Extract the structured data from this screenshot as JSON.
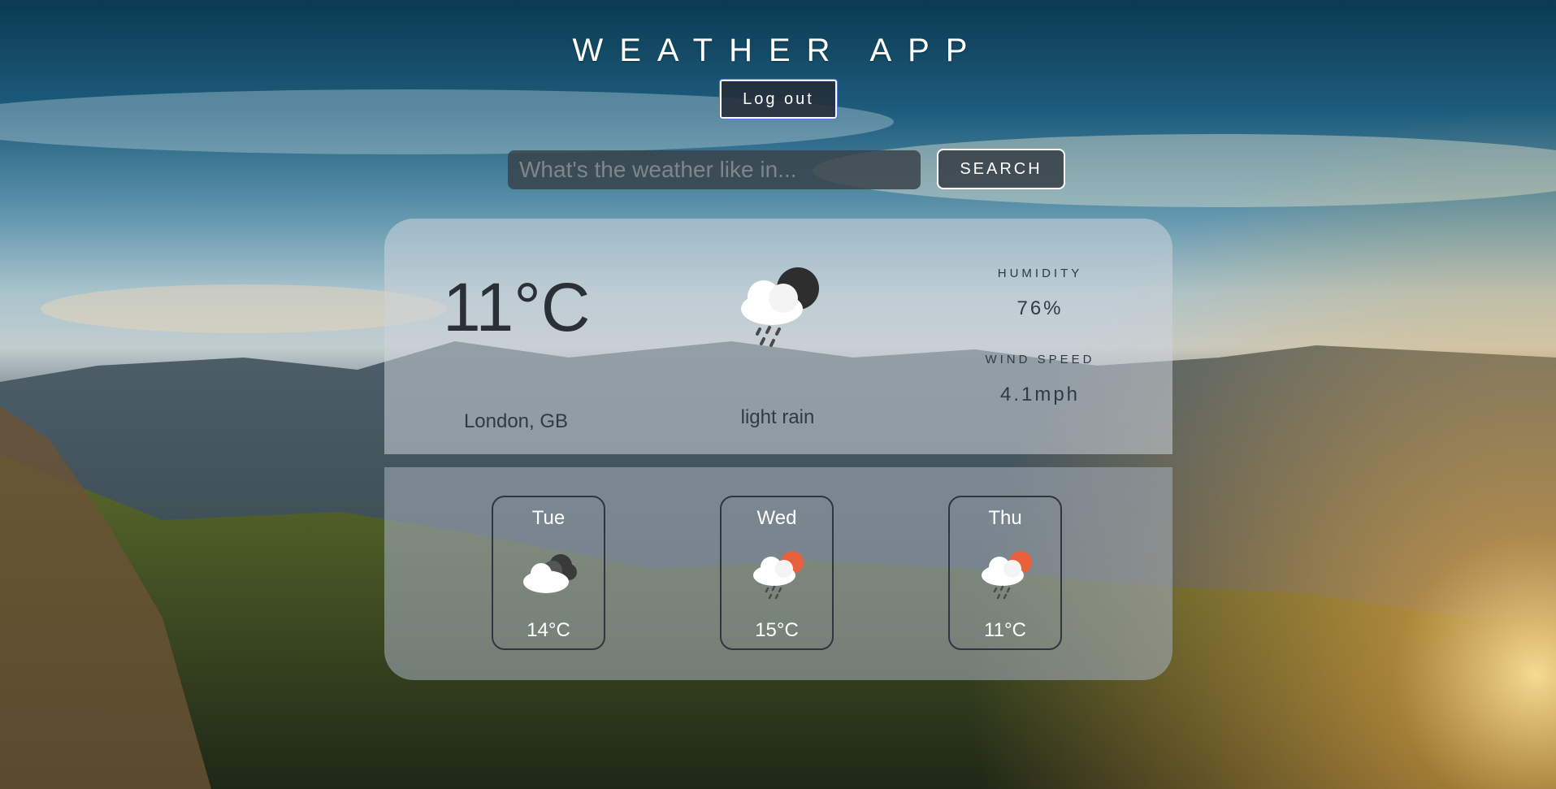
{
  "header": {
    "title": "WEATHER APP",
    "logout_label": "Log out"
  },
  "search": {
    "placeholder": "What's the weather like in...",
    "value": "",
    "button_label": "SEARCH"
  },
  "current": {
    "temperature": "11°C",
    "location": "London, GB",
    "description": "light rain",
    "icon": "night-rain-cloud-icon",
    "humidity_label": "HUMIDITY",
    "humidity_value": "76%",
    "wind_label": "WIND SPEED",
    "wind_value": "4.1mph"
  },
  "forecast": [
    {
      "day": "Tue",
      "temp": "14°C",
      "icon": "broken-clouds-icon"
    },
    {
      "day": "Wed",
      "temp": "15°C",
      "icon": "sun-rain-cloud-icon"
    },
    {
      "day": "Thu",
      "temp": "11°C",
      "icon": "sun-rain-cloud-icon"
    }
  ],
  "colors": {
    "sun": "#e8603c",
    "dark_cloud": "#3a3a3a",
    "panel_text": "#2f3a44"
  }
}
